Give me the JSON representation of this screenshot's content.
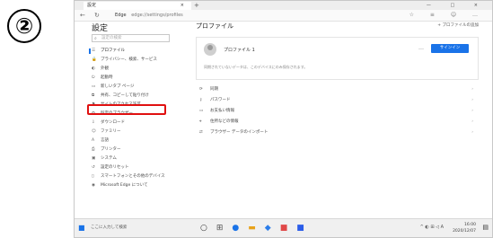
{
  "step_marker": "②",
  "browser": {
    "tab_title": "設定",
    "tab_close": "×",
    "new_tab": "+",
    "window_controls": "— □ ×",
    "nav_back": "←",
    "nav_refresh": "↻",
    "url_prefix": "Edge",
    "url": "edge://settings/profiles",
    "toolbar_icons": "☆ ≡ ☺ …"
  },
  "sidebar": {
    "title": "設定",
    "search_placeholder": "設定の検索",
    "items": [
      {
        "icon": "☰",
        "label": "プロファイル"
      },
      {
        "icon": "🔒",
        "label": "プライバシー、検索、サービス"
      },
      {
        "icon": "◐",
        "label": "外観"
      },
      {
        "icon": "⏻",
        "label": "起動時"
      },
      {
        "icon": "▭",
        "label": "新しいタブ ページ"
      },
      {
        "icon": "⧉",
        "label": "共有、コピーして貼り付け"
      },
      {
        "icon": "⚑",
        "label": "サイトのアクセス許可"
      },
      {
        "icon": "⚙",
        "label": "既定のブラウザー"
      },
      {
        "icon": "⇩",
        "label": "ダウンロード"
      },
      {
        "icon": "☺",
        "label": "ファミリー"
      },
      {
        "icon": "A",
        "label": "言語"
      },
      {
        "icon": "⎙",
        "label": "プリンター"
      },
      {
        "icon": "▣",
        "label": "システム"
      },
      {
        "icon": "↺",
        "label": "設定のリセット"
      },
      {
        "icon": "▯",
        "label": "スマートフォンとその他のデバイス"
      },
      {
        "icon": "◉",
        "label": "Microsoft Edge について"
      }
    ]
  },
  "main": {
    "title": "プロファイル",
    "add_profile": "+ プロファイルの追加",
    "profile": {
      "name": "プロファイル 1",
      "more": "…",
      "signin_label": "サインイン",
      "note": "同期されていないデータは、このデバイスにのみ保存されます。"
    },
    "settings_rows": [
      {
        "icon": "⟳",
        "label": "同期"
      },
      {
        "icon": "⚷",
        "label": "パスワード"
      },
      {
        "icon": "▭",
        "label": "お支払い情報"
      },
      {
        "icon": "⌖",
        "label": "住所などの情報"
      },
      {
        "icon": "⇄",
        "label": "ブラウザー データのインポート"
      }
    ],
    "chevron": "›"
  },
  "taskbar": {
    "start": "■",
    "search": "ここに入力して検索",
    "apps": [
      {
        "glyph": "○",
        "color": "#333333"
      },
      {
        "glyph": "⊞",
        "color": "#555555"
      },
      {
        "glyph": "●",
        "color": "#1a73e8"
      },
      {
        "glyph": "▬",
        "color": "#e8a21a"
      },
      {
        "glyph": "◆",
        "color": "#2b7de9"
      },
      {
        "glyph": "■",
        "color": "#e04848"
      },
      {
        "glyph": "■",
        "color": "#2b5de9"
      }
    ],
    "tray_icons": "^ ◐ ⊞ ◁ A",
    "time": "16:00",
    "date": "2020/12/07",
    "notify": "▤"
  },
  "colors": {
    "accent": "#1a73e8",
    "highlight": "#e01010"
  }
}
